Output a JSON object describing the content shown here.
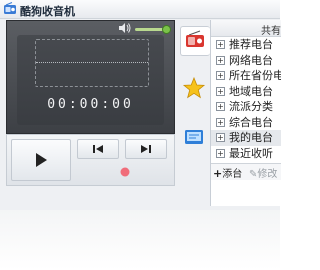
{
  "window": {
    "title": "酷狗收音机",
    "icon": "radio-app-icon"
  },
  "player": {
    "time": "00:00:00",
    "volume_level": 0.9
  },
  "controls": {
    "play_icon": "play-icon",
    "prev_icon": "previous-icon",
    "next_icon": "next-icon",
    "record_icon": "record-icon"
  },
  "sidebar": {
    "items": [
      {
        "icon": "radio-icon",
        "active": true
      },
      {
        "icon": "star-icon",
        "active": false
      },
      {
        "icon": "screen-icon",
        "active": false
      }
    ]
  },
  "list": {
    "header": "共有",
    "items": [
      {
        "label": "推荐电台",
        "selected": false
      },
      {
        "label": "网络电台",
        "selected": false
      },
      {
        "label": "所在省份电台",
        "selected": false
      },
      {
        "label": "地域电台",
        "selected": false
      },
      {
        "label": "流派分类",
        "selected": false
      },
      {
        "label": "综合电台",
        "selected": false
      },
      {
        "label": "我的电台",
        "selected": true
      },
      {
        "label": "最近收听",
        "selected": false
      }
    ],
    "add_label": "添台",
    "edit_label": "修改"
  }
}
